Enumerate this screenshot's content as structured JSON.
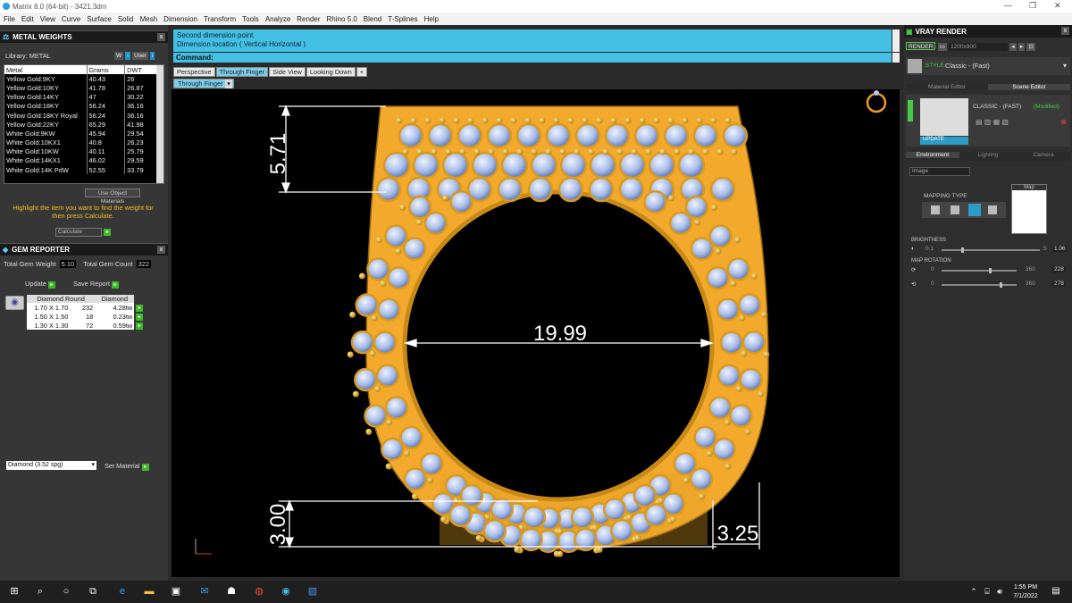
{
  "window": {
    "title": "Matrix 8.0 (64-bit) - 3421.3dm"
  },
  "menu": [
    "File",
    "Edit",
    "View",
    "Curve",
    "Surface",
    "Solid",
    "Mesh",
    "Dimension",
    "Transform",
    "Tools",
    "Analyze",
    "Render",
    "Rhino 5.0",
    "Blend",
    "T-Splines",
    "Help"
  ],
  "metal_weights": {
    "title": "METAL WEIGHTS",
    "library": "Library: METAL",
    "columns": [
      "Metal",
      "Grams",
      "DWT"
    ],
    "rows": [
      [
        "Yellow Gold:9KY",
        "40.43",
        "26"
      ],
      [
        "Yellow Gold:10KY",
        "41.78",
        "26.87"
      ],
      [
        "Yellow Gold:14KY",
        "47",
        "30.22"
      ],
      [
        "Yellow Gold:18KY",
        "56.24",
        "36.16"
      ],
      [
        "Yellow Gold:18KY Royal",
        "56.24",
        "36.16"
      ],
      [
        "Yellow Gold:22KY",
        "65.29",
        "41.98"
      ],
      [
        "White Gold:9KW",
        "45.94",
        "29.54"
      ],
      [
        "White Gold:10KX1",
        "40.8",
        "26.23"
      ],
      [
        "White Gold:10KW",
        "40.11",
        "25.79"
      ],
      [
        "White Gold:14KX1",
        "46.02",
        "29.59"
      ],
      [
        "White Gold:14K PdW",
        "52.55",
        "33.79"
      ]
    ],
    "use_object_materials": "Use Object Materials",
    "hint": "Highlight the item you want to find the weight for then press Calculate.",
    "calculate": "Calculate"
  },
  "gem_reporter": {
    "title": "GEM REPORTER",
    "total_weight_label": "Total Gem Weight",
    "total_weight": "5.10",
    "total_count_label": "Total Gem Count",
    "total_count": "322",
    "update": "Update",
    "save_report": "Save Report",
    "col1": "Diamond Round",
    "col2": "Diamond",
    "rows": [
      [
        "1.70 X 1.70",
        "232",
        "4.28tw"
      ],
      [
        "1.50 X 1.50",
        "18",
        "0.23tw"
      ],
      [
        "1.30 X 1.30",
        "72",
        "0.59tw"
      ]
    ],
    "material": "Diamond     (3.52 spg)",
    "set_material": "Set Material"
  },
  "status": {
    "line1": "Second dimension point.",
    "line2": "Dimension location ( Vertical  Horizontal )",
    "command_label": "Command:"
  },
  "tabs": [
    "Perspective",
    "Through Finger",
    "Side View",
    "Looking Down",
    "+"
  ],
  "view_label": "Through Finger",
  "dimensions": {
    "top": "5.71",
    "inner": "19.99",
    "bottom": "3.00",
    "side": "3.25"
  },
  "vray": {
    "title": "VRAY RENDER",
    "render": "RENDER",
    "resolution": "1200x900",
    "style_label": "STYLE:",
    "style": "Classic - (Fast)",
    "tab_material": "Material Editor",
    "tab_scene": "Scene Editor",
    "preset": "CLASSIC - (FAST)",
    "modified": "(Modified)",
    "update": "UPDATE",
    "subtabs": [
      "Environment",
      "Lighting",
      "Camera"
    ],
    "env_type": "Image",
    "mapping_type": "MAPPING TYPE",
    "map": "Map",
    "brightness_label": "BRIGHTNESS",
    "brightness_min": "0.1",
    "brightness_max": "5",
    "brightness": "1.06",
    "map_rotation_label": "MAP ROTATION",
    "rot1_min": "0",
    "rot1_max": "360",
    "rot1": "228",
    "rot2_min": "0",
    "rot2_max": "360",
    "rot2": "278"
  },
  "taskbar": {
    "time": "1:55 PM",
    "date": "7/1/2022"
  }
}
